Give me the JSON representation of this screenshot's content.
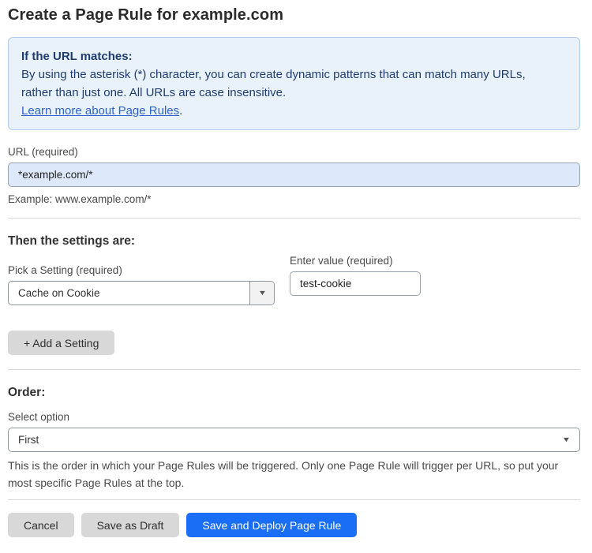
{
  "page": {
    "title": "Create a Page Rule for example.com"
  },
  "info_box": {
    "heading": "If the URL matches:",
    "body_lines": [
      "By using the asterisk (*) character, you can create dynamic patterns that can match many URLs,",
      "rather than just one. All URLs are case insensitive."
    ],
    "link_label": "Learn more about Page Rules",
    "link_suffix": "."
  },
  "url_field": {
    "label": "URL (required)",
    "value": "*example.com/*",
    "example": "Example: www.example.com/*"
  },
  "settings_section": {
    "heading": "Then the settings are:",
    "setting_picker": {
      "label": "Pick a Setting (required)",
      "value": "Cache on Cookie"
    },
    "value_field": {
      "label": "Enter value (required)",
      "value": "test-cookie"
    },
    "add_setting_label": "+ Add a Setting"
  },
  "order_section": {
    "heading": "Order:",
    "select_label": "Select option",
    "selected_option": "First",
    "help_lines": [
      "This is the order in which your Page Rules will be triggered. Only one Page Rule will trigger per URL, so put your",
      "most specific Page Rules at the top."
    ]
  },
  "actions": {
    "cancel_label": "Cancel",
    "save_draft_label": "Save as Draft",
    "save_deploy_label": "Save and Deploy Page Rule"
  },
  "icons": {
    "dropdown_arrow": "▼"
  },
  "colors": {
    "info_bg": "#e9f1fb",
    "info_border": "#b0cdec",
    "info_text": "#1e3c6e",
    "link": "#2d63c8",
    "url_input_bg": "#dde9fa",
    "primary_button": "#1a6ef5",
    "secondary_button": "#d8d8d8"
  }
}
